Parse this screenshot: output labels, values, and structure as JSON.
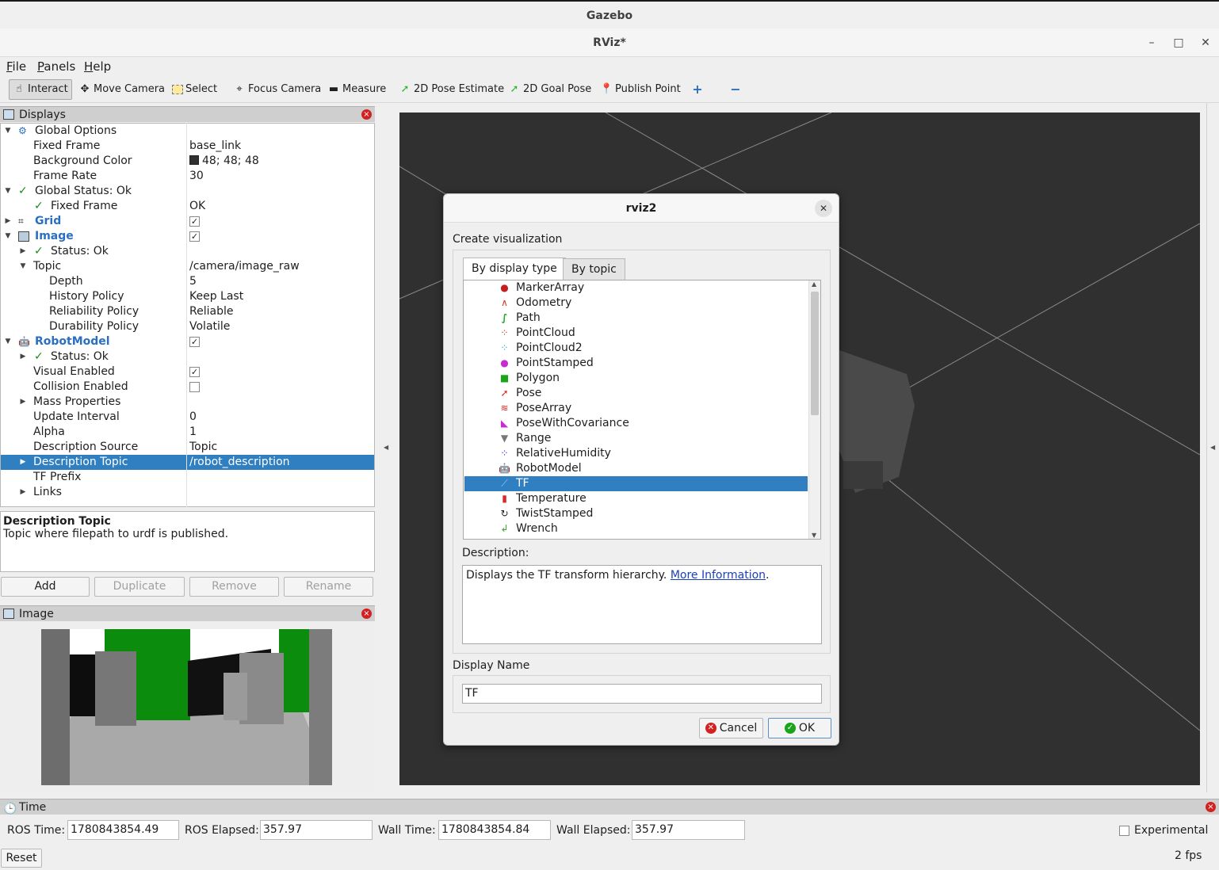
{
  "outer_title": "Gazebo",
  "window": {
    "title": "RViz*",
    "min": "–",
    "max": "□",
    "close": "✕"
  },
  "menu": [
    "File",
    "Panels",
    "Help"
  ],
  "toolbar": {
    "interact": "Interact",
    "move_camera": "Move Camera",
    "select": "Select",
    "focus_camera": "Focus Camera",
    "measure": "Measure",
    "pose_estimate": "2D Pose Estimate",
    "goal_pose": "2D Goal Pose",
    "publish_point": "Publish Point"
  },
  "displays_panel": {
    "title": "Displays",
    "rows": [
      {
        "label": "Global Options",
        "value": ""
      },
      {
        "label": "Fixed Frame",
        "value": "base_link"
      },
      {
        "label": "Background Color",
        "value": "48; 48; 48"
      },
      {
        "label": "Frame Rate",
        "value": "30"
      },
      {
        "label": "Global Status: Ok",
        "value": ""
      },
      {
        "label": "Fixed Frame",
        "value": "OK"
      },
      {
        "label": "Grid",
        "value": ""
      },
      {
        "label": "Image",
        "value": ""
      },
      {
        "label": "Status: Ok",
        "value": ""
      },
      {
        "label": "Topic",
        "value": "/camera/image_raw"
      },
      {
        "label": "Depth",
        "value": "5"
      },
      {
        "label": "History Policy",
        "value": "Keep Last"
      },
      {
        "label": "Reliability Policy",
        "value": "Reliable"
      },
      {
        "label": "Durability Policy",
        "value": "Volatile"
      },
      {
        "label": "RobotModel",
        "value": ""
      },
      {
        "label": "Status: Ok",
        "value": ""
      },
      {
        "label": "Visual Enabled",
        "value": ""
      },
      {
        "label": "Collision Enabled",
        "value": ""
      },
      {
        "label": "Mass Properties",
        "value": ""
      },
      {
        "label": "Update Interval",
        "value": "0"
      },
      {
        "label": "Alpha",
        "value": "1"
      },
      {
        "label": "Description Source",
        "value": "Topic"
      },
      {
        "label": "Description Topic",
        "value": "/robot_description"
      },
      {
        "label": "TF Prefix",
        "value": ""
      },
      {
        "label": "Links",
        "value": ""
      }
    ],
    "checkbox_states": {
      "grid": true,
      "image": true,
      "robotmodel": true,
      "visual_enabled": true,
      "collision_enabled": false
    },
    "background_color": "#303030",
    "description": {
      "title": "Description Topic",
      "text": "Topic where filepath to urdf is published."
    },
    "buttons": {
      "add": "Add",
      "duplicate": "Duplicate",
      "remove": "Remove",
      "rename": "Rename"
    }
  },
  "image_panel": {
    "title": "Image"
  },
  "dialog": {
    "title": "rviz2",
    "heading": "Create visualization",
    "tabs": {
      "by_display_type": "By display type",
      "by_topic": "By topic"
    },
    "items": [
      {
        "label": "MarkerArray",
        "icon": "marker-array-icon"
      },
      {
        "label": "Odometry",
        "icon": "odometry-icon"
      },
      {
        "label": "Path",
        "icon": "path-icon"
      },
      {
        "label": "PointCloud",
        "icon": "pointcloud-icon"
      },
      {
        "label": "PointCloud2",
        "icon": "pointcloud2-icon"
      },
      {
        "label": "PointStamped",
        "icon": "point-stamped-icon"
      },
      {
        "label": "Polygon",
        "icon": "polygon-icon"
      },
      {
        "label": "Pose",
        "icon": "pose-icon"
      },
      {
        "label": "PoseArray",
        "icon": "pose-array-icon"
      },
      {
        "label": "PoseWithCovariance",
        "icon": "pose-covariance-icon"
      },
      {
        "label": "Range",
        "icon": "range-icon"
      },
      {
        "label": "RelativeHumidity",
        "icon": "humidity-icon"
      },
      {
        "label": "RobotModel",
        "icon": "robot-model-icon"
      },
      {
        "label": "TF",
        "icon": "tf-icon"
      },
      {
        "label": "Temperature",
        "icon": "temperature-icon"
      },
      {
        "label": "TwistStamped",
        "icon": "twist-icon"
      },
      {
        "label": "Wrench",
        "icon": "wrench-icon"
      }
    ],
    "selected": "TF",
    "description_label": "Description:",
    "description_text": "Displays the TF transform hierarchy. ",
    "description_link": "More Information",
    "description_end": ".",
    "display_name_label": "Display Name",
    "display_name_value": "TF",
    "cancel": "Cancel",
    "ok": "OK"
  },
  "time_panel": {
    "title": "Time",
    "ros_time_label": "ROS Time:",
    "ros_time": "1780843854.49",
    "ros_elapsed_label": "ROS Elapsed:",
    "ros_elapsed": "357.97",
    "wall_time_label": "Wall Time:",
    "wall_time": "1780843854.84",
    "wall_elapsed_label": "Wall Elapsed:",
    "wall_elapsed": "357.97",
    "experimental": "Experimental",
    "reset": "Reset",
    "fps": "2 fps"
  }
}
